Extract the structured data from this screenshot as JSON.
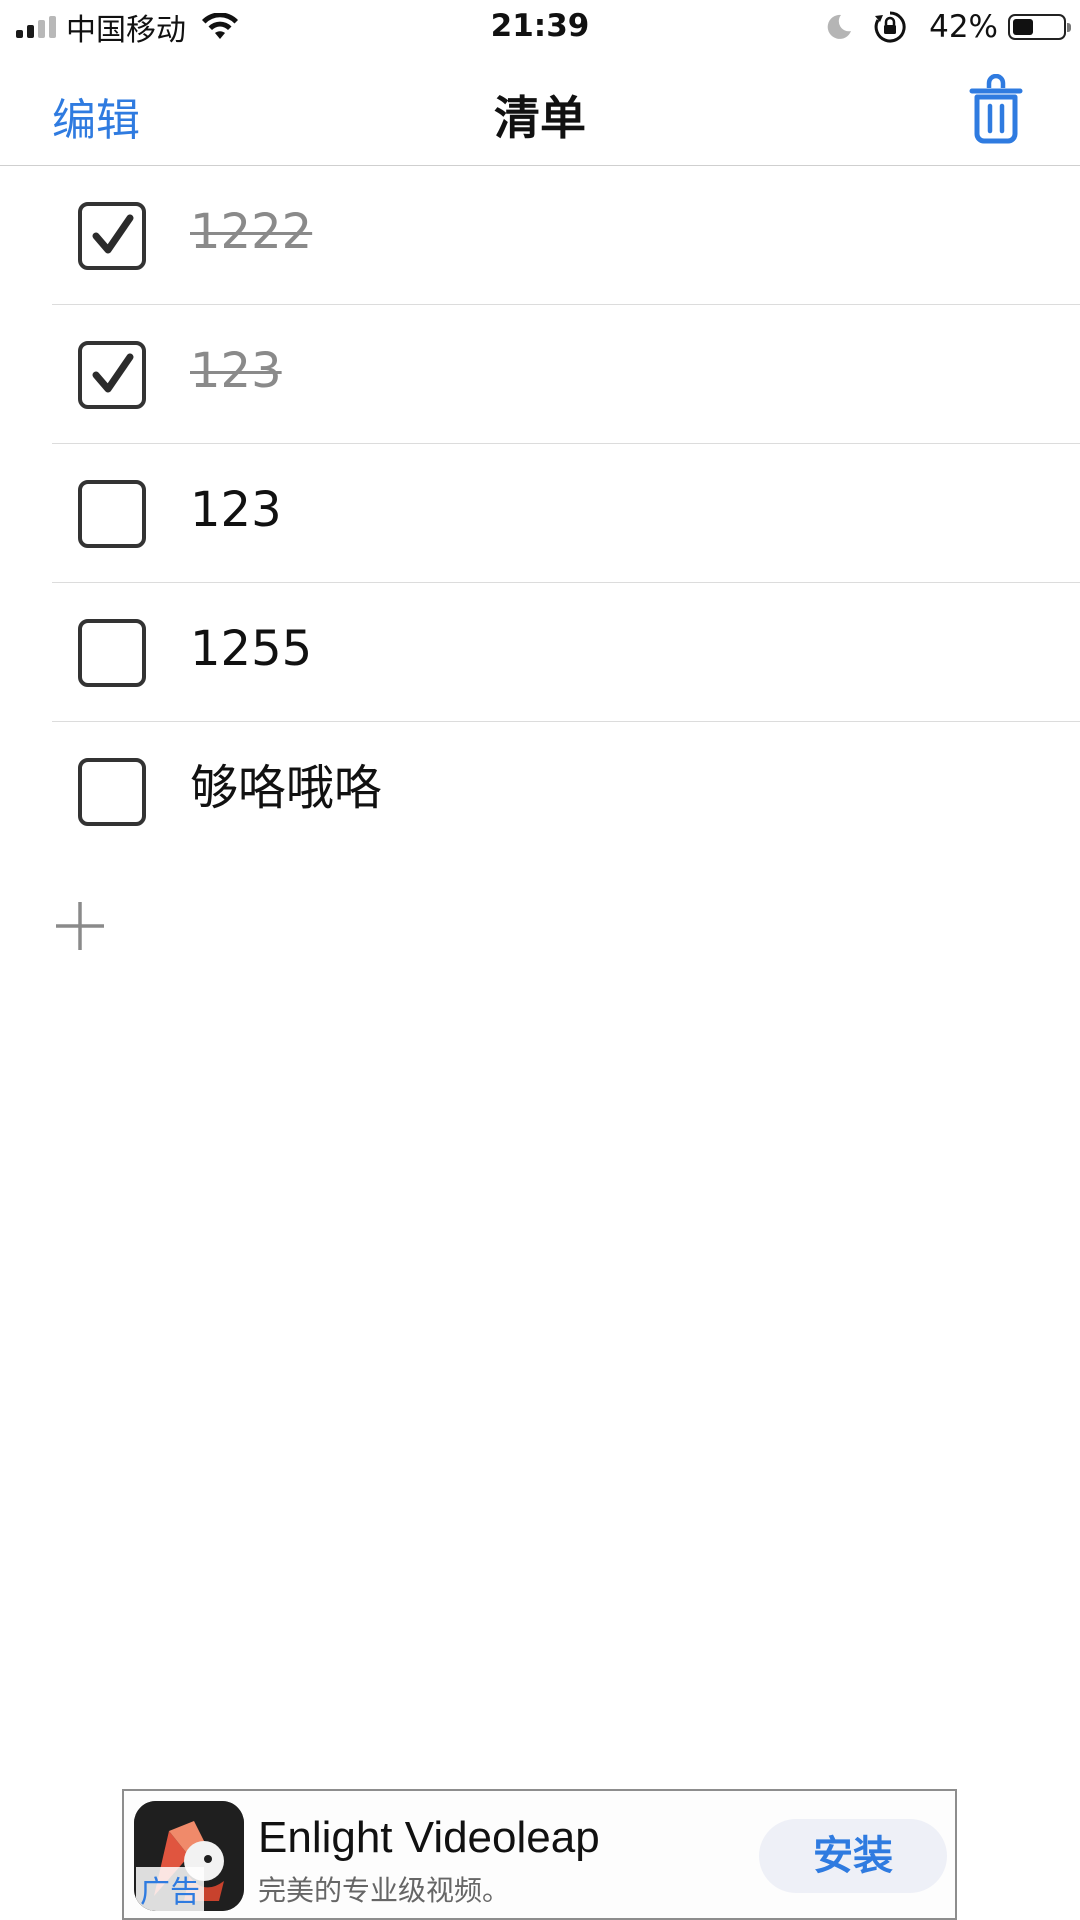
{
  "status_bar": {
    "carrier": "中国移动",
    "time": "21:39",
    "battery_percent": "42%",
    "battery_level": 0.42,
    "icons": [
      "signal-icon",
      "wifi-icon",
      "moon-icon",
      "rotation-lock-icon",
      "battery-icon"
    ]
  },
  "nav": {
    "edit_label": "编辑",
    "title": "清单",
    "accent_color": "#2f7be0"
  },
  "todos": [
    {
      "text": "1222",
      "checked": true
    },
    {
      "text": "123",
      "checked": true
    },
    {
      "text": "123",
      "checked": false
    },
    {
      "text": "1255",
      "checked": false
    },
    {
      "text": "够咯哦咯",
      "checked": false
    }
  ],
  "ad": {
    "tag": "广告",
    "title": "Enlight Videoleap",
    "subtitle": "完美的专业级视频。",
    "install_label": "安装"
  }
}
